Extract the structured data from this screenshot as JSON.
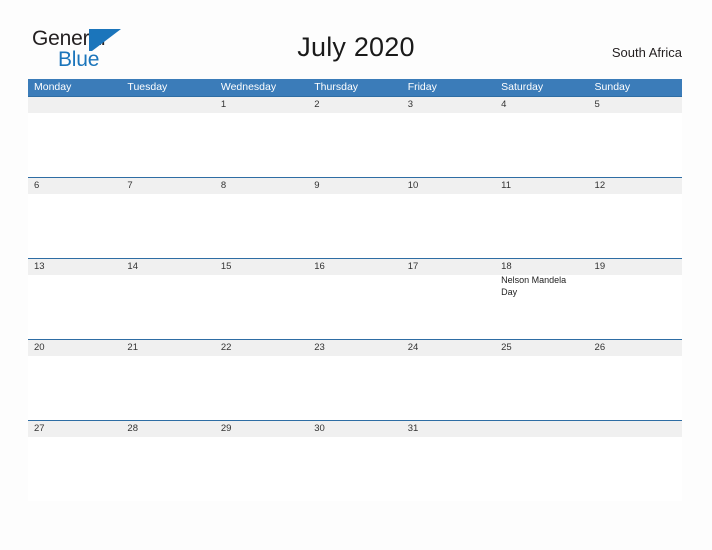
{
  "header": {
    "logo": {
      "line1": "General",
      "line2": "Blue",
      "mark": "triangle-flag-icon"
    },
    "title": "July 2020",
    "region": "South Africa"
  },
  "calendar": {
    "weekdays": [
      "Monday",
      "Tuesday",
      "Wednesday",
      "Thursday",
      "Friday",
      "Saturday",
      "Sunday"
    ],
    "weeks": [
      {
        "days": [
          {
            "num": "",
            "events": []
          },
          {
            "num": "",
            "events": []
          },
          {
            "num": "1",
            "events": []
          },
          {
            "num": "2",
            "events": []
          },
          {
            "num": "3",
            "events": []
          },
          {
            "num": "4",
            "events": []
          },
          {
            "num": "5",
            "events": []
          }
        ]
      },
      {
        "days": [
          {
            "num": "6",
            "events": []
          },
          {
            "num": "7",
            "events": []
          },
          {
            "num": "8",
            "events": []
          },
          {
            "num": "9",
            "events": []
          },
          {
            "num": "10",
            "events": []
          },
          {
            "num": "11",
            "events": []
          },
          {
            "num": "12",
            "events": []
          }
        ]
      },
      {
        "days": [
          {
            "num": "13",
            "events": []
          },
          {
            "num": "14",
            "events": []
          },
          {
            "num": "15",
            "events": []
          },
          {
            "num": "16",
            "events": []
          },
          {
            "num": "17",
            "events": []
          },
          {
            "num": "18",
            "events": [
              "Nelson Mandela Day"
            ]
          },
          {
            "num": "19",
            "events": []
          }
        ]
      },
      {
        "days": [
          {
            "num": "20",
            "events": []
          },
          {
            "num": "21",
            "events": []
          },
          {
            "num": "22",
            "events": []
          },
          {
            "num": "23",
            "events": []
          },
          {
            "num": "24",
            "events": []
          },
          {
            "num": "25",
            "events": []
          },
          {
            "num": "26",
            "events": []
          }
        ]
      },
      {
        "days": [
          {
            "num": "27",
            "events": []
          },
          {
            "num": "28",
            "events": []
          },
          {
            "num": "29",
            "events": []
          },
          {
            "num": "30",
            "events": []
          },
          {
            "num": "31",
            "events": []
          },
          {
            "num": "",
            "events": []
          },
          {
            "num": "",
            "events": []
          }
        ]
      }
    ]
  },
  "colors": {
    "header_blue": "#3b7cb9",
    "rule_blue": "#2e6da4",
    "band_gray": "#f0f0f0",
    "logo_blue": "#1b75bb"
  }
}
